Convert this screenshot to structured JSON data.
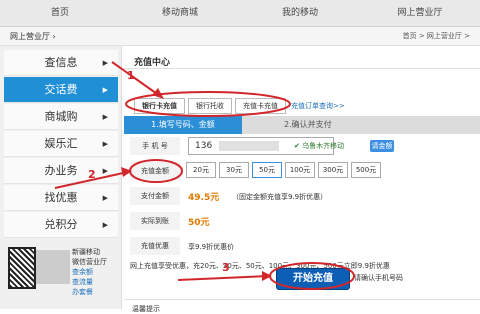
{
  "topnav": [
    "首页",
    "移动商城",
    "我的移动",
    "网上营业厅"
  ],
  "breadcrumb": {
    "left": "网上营业厅 ›",
    "right": "首页 >  网上营业厅 >"
  },
  "sidebar": {
    "items": [
      {
        "label": "查信息",
        "arrow": "▶"
      },
      {
        "label": "交话费",
        "arrow": "▶"
      },
      {
        "label": "商城购",
        "arrow": "▶"
      },
      {
        "label": "娱乐汇",
        "arrow": "▶"
      },
      {
        "label": "办业务",
        "arrow": "▶"
      },
      {
        "label": "找优惠",
        "arrow": "▶"
      },
      {
        "label": "兑积分",
        "arrow": "▶"
      }
    ],
    "footer": {
      "line1": "新疆移动",
      "line2": "微信营业厅",
      "link1": "查余额",
      "link2": "查流量",
      "link3": "办套餐"
    }
  },
  "main": {
    "title": "充值中心",
    "tabs": [
      "银行卡充值",
      "银行托收",
      "充值卡充值"
    ],
    "query_link": "充值订单查询>>",
    "steps": [
      "1.填写号码、金额",
      "2.确认并支付"
    ],
    "labels": {
      "phone": "手 机 号",
      "amount": "充值金额",
      "pay": "支付金额",
      "points": "实际到账",
      "discount": "充值优惠"
    },
    "phone_value": "136",
    "location": "✔ 乌鲁木齐移动",
    "change_btn": "请金额",
    "amounts": [
      "20元",
      "30元",
      "50元",
      "100元",
      "300元",
      "500元"
    ],
    "pay_amount": "49.5元",
    "pay_note": "（固定金额充值享9.9折优惠）",
    "points_amount": "50元",
    "discount_note": "享9.9折优惠价",
    "promo_text": "网上充值享受优惠，充20元、30元、50元、100元、300元、500元立即9.9折优惠",
    "submit": "开始充值",
    "agree_text": "请确认手机号码",
    "footer_text": "温馨提示"
  },
  "annotations": {
    "n1": "1",
    "n2": "2",
    "n3": "3"
  },
  "colors": {
    "accent": "#1f8fd6",
    "button": "#0d5fb5",
    "annotation": "#d1262b",
    "price": "#e07a00"
  }
}
